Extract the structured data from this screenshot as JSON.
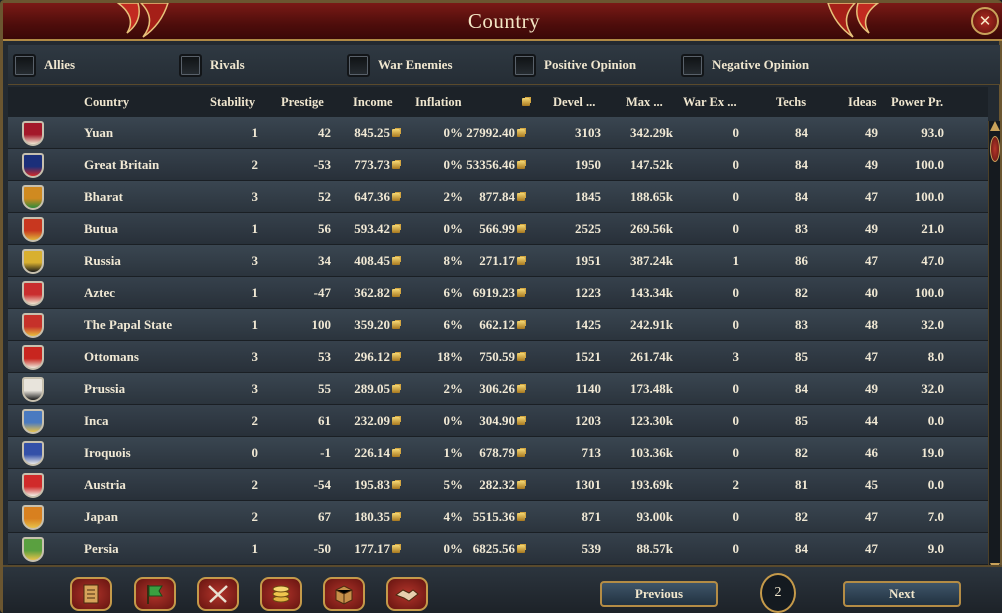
{
  "window": {
    "title": "Country"
  },
  "filters": [
    "Allies",
    "Rivals",
    "War Enemies",
    "Positive Opinion",
    "Negative Opinion"
  ],
  "columns": [
    "Country",
    "Stability",
    "Prestige",
    "Income",
    "Inflation",
    "",
    "Devel ...",
    "Max ...",
    "War Ex ...",
    "Techs",
    "Ideas",
    "Power Pr."
  ],
  "rows": [
    {
      "country": "Yuan",
      "stability": "1",
      "prestige": "42",
      "income": "845.25",
      "inflation": "0%",
      "treasury": "27992.40",
      "devel": "3103",
      "max": "342.29k",
      "warex": "0",
      "techs": "84",
      "ideas": "49",
      "power": "93.0",
      "flag_color": "#a3182a",
      "flag_accent": "#f1e6d2"
    },
    {
      "country": "Great Britain",
      "stability": "2",
      "prestige": "-53",
      "income": "773.73",
      "inflation": "0%",
      "treasury": "53356.46",
      "devel": "1950",
      "max": "147.52k",
      "warex": "0",
      "techs": "84",
      "ideas": "49",
      "power": "100.0",
      "flag_color": "#1b2f7a",
      "flag_accent": "#d32a2a"
    },
    {
      "country": "Bharat",
      "stability": "3",
      "prestige": "52",
      "income": "647.36",
      "inflation": "2%",
      "treasury": "877.84",
      "devel": "1845",
      "max": "188.65k",
      "warex": "0",
      "techs": "84",
      "ideas": "47",
      "power": "100.0",
      "flag_color": "#d08a20",
      "flag_accent": "#2f8a3a"
    },
    {
      "country": "Butua",
      "stability": "1",
      "prestige": "56",
      "income": "593.42",
      "inflation": "0%",
      "treasury": "566.99",
      "devel": "2525",
      "max": "269.56k",
      "warex": "0",
      "techs": "83",
      "ideas": "49",
      "power": "21.0",
      "flag_color": "#c8371f",
      "flag_accent": "#e0b43a"
    },
    {
      "country": "Russia",
      "stability": "3",
      "prestige": "34",
      "income": "408.45",
      "inflation": "8%",
      "treasury": "271.17",
      "devel": "1951",
      "max": "387.24k",
      "warex": "1",
      "techs": "86",
      "ideas": "47",
      "power": "47.0",
      "flag_color": "#d8b030",
      "flag_accent": "#1a1a1a"
    },
    {
      "country": "Aztec",
      "stability": "1",
      "prestige": "-47",
      "income": "362.82",
      "inflation": "6%",
      "treasury": "6919.23",
      "devel": "1223",
      "max": "143.34k",
      "warex": "0",
      "techs": "82",
      "ideas": "40",
      "power": "100.0",
      "flag_color": "#c92e2e",
      "flag_accent": "#f0e4d0"
    },
    {
      "country": "The Papal State",
      "stability": "1",
      "prestige": "100",
      "income": "359.20",
      "inflation": "6%",
      "treasury": "662.12",
      "devel": "1425",
      "max": "242.91k",
      "warex": "0",
      "techs": "83",
      "ideas": "48",
      "power": "32.0",
      "flag_color": "#c6312a",
      "flag_accent": "#e8c040"
    },
    {
      "country": "Ottomans",
      "stability": "3",
      "prestige": "53",
      "income": "296.12",
      "inflation": "18%",
      "treasury": "750.59",
      "devel": "1521",
      "max": "261.74k",
      "warex": "3",
      "techs": "85",
      "ideas": "47",
      "power": "8.0",
      "flag_color": "#c8261f",
      "flag_accent": "#f0eadc"
    },
    {
      "country": "Prussia",
      "stability": "3",
      "prestige": "55",
      "income": "289.05",
      "inflation": "2%",
      "treasury": "306.26",
      "devel": "1140",
      "max": "173.48k",
      "warex": "0",
      "techs": "84",
      "ideas": "49",
      "power": "32.0",
      "flag_color": "#e8e4dc",
      "flag_accent": "#1a1a1a"
    },
    {
      "country": "Inca",
      "stability": "2",
      "prestige": "61",
      "income": "232.09",
      "inflation": "0%",
      "treasury": "304.90",
      "devel": "1203",
      "max": "123.30k",
      "warex": "0",
      "techs": "85",
      "ideas": "44",
      "power": "0.0",
      "flag_color": "#4a7ac0",
      "flag_accent": "#e8c24a"
    },
    {
      "country": "Iroquois",
      "stability": "0",
      "prestige": "-1",
      "income": "226.14",
      "inflation": "1%",
      "treasury": "678.79",
      "devel": "713",
      "max": "103.36k",
      "warex": "0",
      "techs": "82",
      "ideas": "46",
      "power": "19.0",
      "flag_color": "#3450a8",
      "flag_accent": "#e8e8e8"
    },
    {
      "country": "Austria",
      "stability": "2",
      "prestige": "-54",
      "income": "195.83",
      "inflation": "5%",
      "treasury": "282.32",
      "devel": "1301",
      "max": "193.69k",
      "warex": "2",
      "techs": "81",
      "ideas": "45",
      "power": "0.0",
      "flag_color": "#d02a2a",
      "flag_accent": "#f4f0e8"
    },
    {
      "country": "Japan",
      "stability": "2",
      "prestige": "67",
      "income": "180.35",
      "inflation": "4%",
      "treasury": "5515.36",
      "devel": "871",
      "max": "93.00k",
      "warex": "0",
      "techs": "82",
      "ideas": "47",
      "power": "7.0",
      "flag_color": "#d8801f",
      "flag_accent": "#e8c24a"
    },
    {
      "country": "Persia",
      "stability": "1",
      "prestige": "-50",
      "income": "177.17",
      "inflation": "0%",
      "treasury": "6825.56",
      "devel": "539",
      "max": "88.57k",
      "warex": "0",
      "techs": "84",
      "ideas": "47",
      "power": "9.0",
      "flag_color": "#5aa040",
      "flag_accent": "#e8c24a"
    }
  ],
  "pagination": {
    "previous_label": "Previous",
    "next_label": "Next",
    "page": "2"
  },
  "icons": [
    "ledger-icon",
    "flag-icon",
    "crossed-swords-icon",
    "coins-icon",
    "crate-icon",
    "handshake-icon",
    "close-icon",
    "coin-icon",
    "checkbox-icon"
  ],
  "colors": {
    "title_bar": "#5e110c",
    "gold_trim": "#c59a4a",
    "row_bg": "#36414c",
    "text": "#f0e8d4"
  }
}
